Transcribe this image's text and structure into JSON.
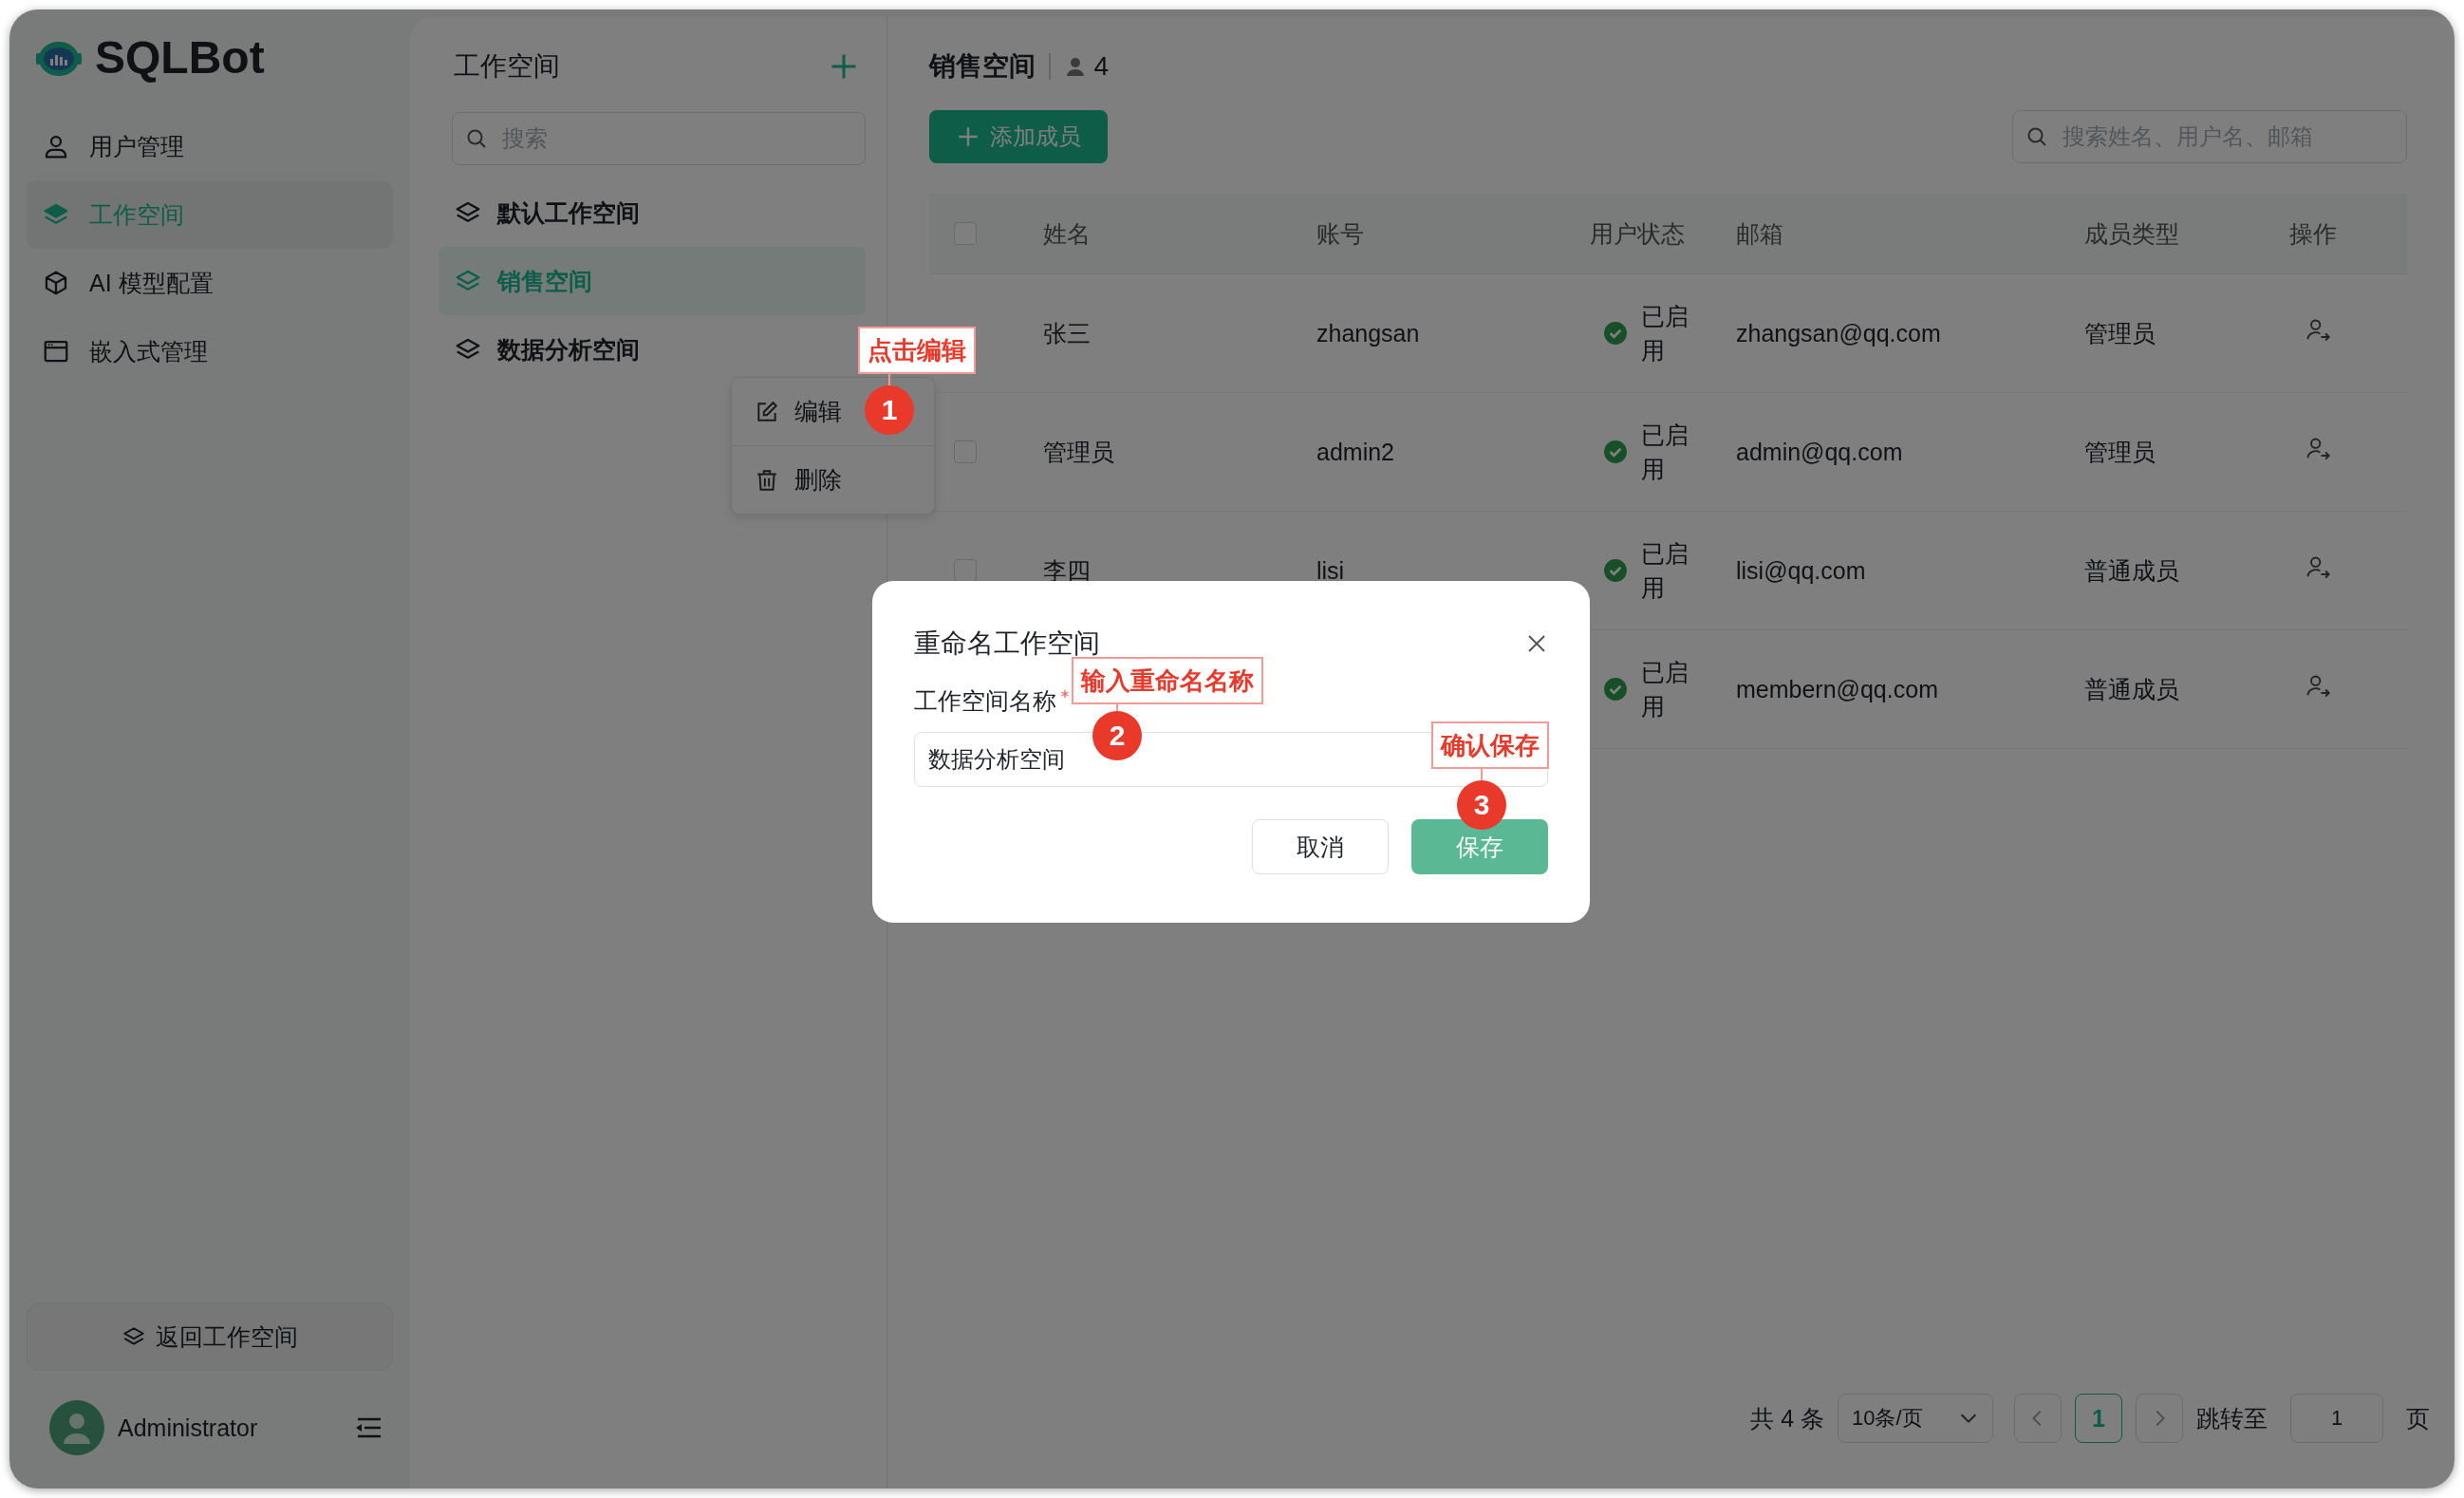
{
  "logo": {
    "text": "SQLBot"
  },
  "sidebar": {
    "items": [
      {
        "label": "用户管理",
        "kind": "user",
        "selected": false
      },
      {
        "label": "工作空间",
        "kind": "layers",
        "selected": true
      },
      {
        "label": "AI 模型配置",
        "kind": "cube",
        "selected": false
      },
      {
        "label": "嵌入式管理",
        "kind": "window",
        "selected": false
      }
    ],
    "back_button": "返回工作空间",
    "user": {
      "name": "Administrator"
    }
  },
  "workspace_panel": {
    "title": "工作空间",
    "search": {
      "placeholder": "搜索"
    },
    "items": [
      {
        "label": "默认工作空间",
        "selected": false
      },
      {
        "label": "销售空间",
        "selected": true
      },
      {
        "label": "数据分析空间",
        "selected": false
      }
    ]
  },
  "context_menu": {
    "items": [
      {
        "label": "编辑",
        "kind": "edit"
      },
      {
        "label": "删除",
        "kind": "trash"
      }
    ]
  },
  "members": {
    "title": "销售空间",
    "member_count": "4",
    "add_button": "添加成员",
    "search": {
      "placeholder": "搜索姓名、用户名、邮箱"
    },
    "table": {
      "select_all_checked": false,
      "columns": [
        "姓名",
        "账号",
        "用户状态",
        "邮箱",
        "成员类型",
        "操作"
      ],
      "rows": [
        {
          "name": "张三",
          "account": "zhangsan",
          "status": "已启用",
          "enabled": true,
          "email": "zhangsan@qq.com",
          "member_type": "管理员"
        },
        {
          "checked": false,
          "name": "管理员",
          "account": "admin2",
          "status": "已启用",
          "enabled": true,
          "email": "admin@qq.com",
          "member_type": "管理员"
        },
        {
          "checked": false,
          "name": "李四",
          "account": "lisi",
          "status": "已启用",
          "enabled": true,
          "email": "lisi@qq.com",
          "member_type": "普通成员"
        },
        {
          "status": "已启用",
          "enabled": true,
          "email": "membern@qq.com",
          "member_type": "普通成员"
        }
      ]
    }
  },
  "pagination": {
    "total": "共 4 条",
    "page_size": "10条/页",
    "pages": [
      {
        "label": "1",
        "selected": true
      }
    ],
    "jump_label": "跳转至",
    "jump_value": "1",
    "page_suffix": "页"
  },
  "dialog": {
    "title": "重命名工作空间",
    "field_label": "工作空间名称",
    "required": true,
    "value": "数据分析空间",
    "cancel": "取消",
    "save": "保存"
  },
  "annotations": [
    {
      "number": "1",
      "text": "点击编辑"
    },
    {
      "number": "2",
      "text": "输入重命名名称"
    },
    {
      "number": "3",
      "text": "确认保存"
    }
  ]
}
